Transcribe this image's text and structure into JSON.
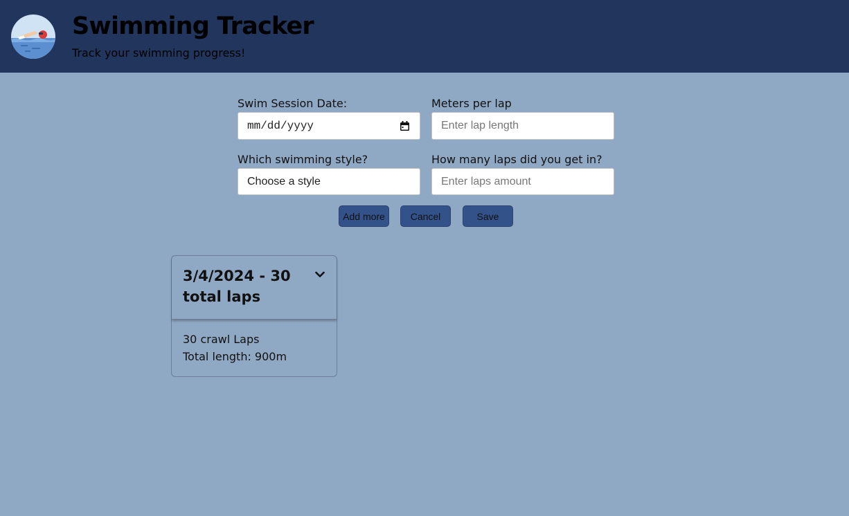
{
  "header": {
    "title": "Swimming Tracker",
    "subtitle": "Track your swimming progress!",
    "logo_icon": "swimmer-icon"
  },
  "form": {
    "date": {
      "label": "Swim Session Date:",
      "value": "mm/dd/yyyy",
      "icon": "calendar-icon"
    },
    "meters": {
      "label": "Meters per lap",
      "placeholder": "Enter lap length"
    },
    "style": {
      "label": "Which swimming style?",
      "selected": "Choose a style"
    },
    "laps": {
      "label": "How many laps did you get in?",
      "placeholder": "Enter laps amount"
    }
  },
  "buttons": {
    "add_more": "Add more",
    "cancel": "Cancel",
    "save": "Save"
  },
  "sessions": [
    {
      "title": "3/4/2024 - 30 total laps",
      "detail": "30 crawl Laps",
      "total": "Total length: 900m",
      "icon": "chevron-down-icon"
    }
  ],
  "colors": {
    "header_bg": "#22355c",
    "page_bg": "#8fa8c4",
    "button_bg": "#34528a"
  }
}
